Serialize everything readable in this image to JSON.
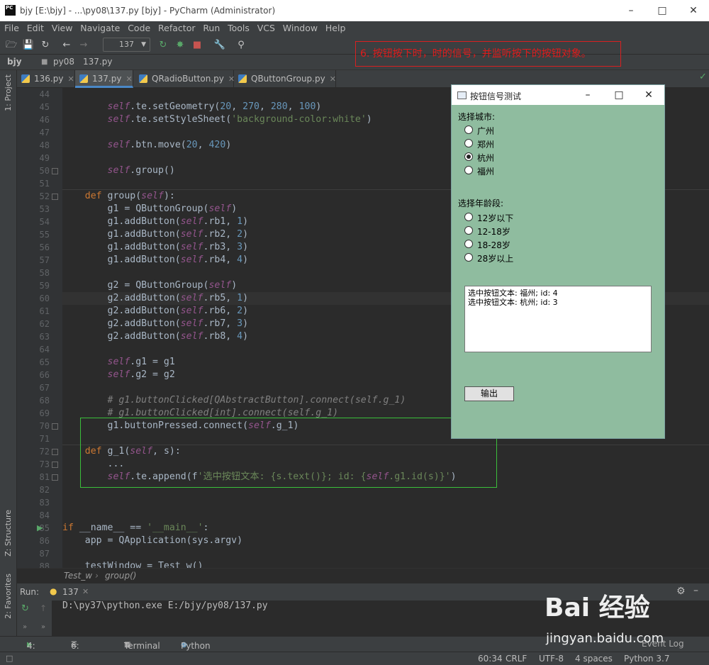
{
  "window": {
    "title": "bjy [E:\\bjy] - ...\\py08\\137.py [bjy] - PyCharm (Administrator)",
    "app_icon": "PC"
  },
  "menu": [
    "File",
    "Edit",
    "View",
    "Navigate",
    "Code",
    "Refactor",
    "Run",
    "Tools",
    "VCS",
    "Window",
    "Help"
  ],
  "toolbar": {
    "run_config": "137"
  },
  "annotation": "6. 按钮按下时，时的信号，并监听按下的按钮对象。",
  "breadcrumb_nav": [
    "bjy",
    "py08",
    "137.py"
  ],
  "tabs": [
    {
      "label": "136.py",
      "active": false
    },
    {
      "label": "137.py",
      "active": true
    },
    {
      "label": "QRadioButton.py",
      "active": false
    },
    {
      "label": "QButtonGroup.py",
      "active": false
    }
  ],
  "side_labels": {
    "project": "1: Project",
    "structure": "Z: Structure",
    "favorites": "2: Favorites"
  },
  "code_lines": [
    {
      "n": "44",
      "t": ""
    },
    {
      "n": "45",
      "t": "        self.te.setGeometry(20, 270, 280, 100)"
    },
    {
      "n": "46",
      "t": "        self.te.setStyleSheet('background-color:white')"
    },
    {
      "n": "47",
      "t": ""
    },
    {
      "n": "48",
      "t": "        self.btn.move(20, 420)"
    },
    {
      "n": "49",
      "t": ""
    },
    {
      "n": "50",
      "t": "        self.group()"
    },
    {
      "n": "51",
      "t": ""
    },
    {
      "n": "52",
      "t": "    def group(self):"
    },
    {
      "n": "53",
      "t": "        g1 = QButtonGroup(self)"
    },
    {
      "n": "54",
      "t": "        g1.addButton(self.rb1, 1)"
    },
    {
      "n": "55",
      "t": "        g1.addButton(self.rb2, 2)"
    },
    {
      "n": "56",
      "t": "        g1.addButton(self.rb3, 3)"
    },
    {
      "n": "57",
      "t": "        g1.addButton(self.rb4, 4)"
    },
    {
      "n": "58",
      "t": ""
    },
    {
      "n": "59",
      "t": "        g2 = QButtonGroup(self)"
    },
    {
      "n": "60",
      "t": "        g2.addButton(self.rb5, 1)"
    },
    {
      "n": "61",
      "t": "        g2.addButton(self.rb6, 2)"
    },
    {
      "n": "62",
      "t": "        g2.addButton(self.rb7, 3)"
    },
    {
      "n": "63",
      "t": "        g2.addButton(self.rb8, 4)"
    },
    {
      "n": "64",
      "t": ""
    },
    {
      "n": "65",
      "t": "        self.g1 = g1"
    },
    {
      "n": "66",
      "t": "        self.g2 = g2"
    },
    {
      "n": "67",
      "t": ""
    },
    {
      "n": "68",
      "t": "        # g1.buttonClicked[QAbstractButton].connect(self.g_1)"
    },
    {
      "n": "69",
      "t": "        # g1.buttonClicked[int].connect(self.g_1)"
    },
    {
      "n": "70",
      "t": "        g1.buttonPressed.connect(self.g_1)"
    },
    {
      "n": "71",
      "t": ""
    },
    {
      "n": "72",
      "t": "    def g_1(self, s):"
    },
    {
      "n": "73",
      "t": "        ..."
    },
    {
      "n": "81",
      "t": "        self.te.append(f'选中按钮文本: {s.text()}; id: {self.g1.id(s)}')"
    },
    {
      "n": "82",
      "t": ""
    },
    {
      "n": "83",
      "t": ""
    },
    {
      "n": "84",
      "t": ""
    },
    {
      "n": "85",
      "t": "if __name__ == '__main__':"
    },
    {
      "n": "86",
      "t": "    app = QApplication(sys.argv)"
    },
    {
      "n": "87",
      "t": ""
    },
    {
      "n": "88",
      "t": "    testWindow = Test_w()"
    }
  ],
  "editor_breadcrumb": [
    "Test_w",
    "group()"
  ],
  "run_panel": {
    "label": "Run:",
    "config": "137",
    "command": "D:\\py37\\python.exe E:/bjy/py08/137.py"
  },
  "bottom_tabs": [
    "4: Run",
    "6: TODO",
    "Terminal",
    "Python Console"
  ],
  "event_log": "Event Log",
  "status": {
    "position": "60:34",
    "line_sep": "CRLF",
    "encoding": "UTF-8",
    "indent": "4 spaces",
    "interpreter": "Python 3.7"
  },
  "qt_window": {
    "title": "按钮信号测试",
    "city_label": "选择城市:",
    "cities": [
      {
        "label": "广州",
        "checked": false
      },
      {
        "label": "郑州",
        "checked": false
      },
      {
        "label": "杭州",
        "checked": true
      },
      {
        "label": "福州",
        "checked": false
      }
    ],
    "age_label": "选择年龄段:",
    "ages": [
      {
        "label": "12岁以下",
        "checked": false
      },
      {
        "label": "12-18岁",
        "checked": false
      },
      {
        "label": "18-28岁",
        "checked": false
      },
      {
        "label": "28岁以上",
        "checked": false
      }
    ],
    "output_lines": [
      "选中按钮文本: 福州; id: 4",
      "选中按钮文本: 杭州; id: 3"
    ],
    "button": "输出"
  },
  "watermark": {
    "brand": "Bai 经验",
    "url": "jingyan.baidu.com"
  },
  "colors": {
    "ide_bg": "#2b2b2b",
    "panel": "#3c3f41",
    "qt_bg": "#8fbc9f",
    "annotation": "#e01b1b",
    "highlight_box": "#3bbf3b"
  }
}
